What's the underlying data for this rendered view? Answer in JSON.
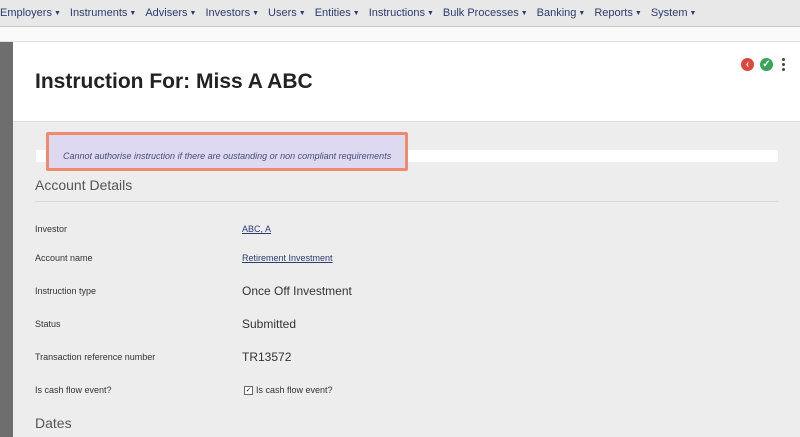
{
  "nav": [
    {
      "label": "Employers"
    },
    {
      "label": "Instruments"
    },
    {
      "label": "Advisers"
    },
    {
      "label": "Investors"
    },
    {
      "label": "Users"
    },
    {
      "label": "Entities"
    },
    {
      "label": "Instructions"
    },
    {
      "label": "Bulk Processes"
    },
    {
      "label": "Banking"
    },
    {
      "label": "Reports"
    },
    {
      "label": "System"
    }
  ],
  "page": {
    "title": "Instruction For: Miss A ABC",
    "message": "Cannot authorise instruction if there are oustanding or non compliant requirements"
  },
  "account_details": {
    "heading": "Account Details",
    "investor_label": "Investor",
    "investor_value": "ABC, A",
    "account_name_label": "Account name",
    "account_name_value": "Retirement Investment",
    "instruction_type_label": "Instruction type",
    "instruction_type_value": "Once Off Investment",
    "status_label": "Status",
    "status_value": "Submitted",
    "txn_ref_label": "Transaction reference number",
    "txn_ref_value": "TR13572",
    "cash_flow_label": "Is cash flow event?",
    "cash_flow_checkbox_label": "Is cash flow event?",
    "cash_flow_checked": true
  },
  "dates": {
    "heading": "Dates"
  },
  "colors": {
    "nav_text": "#2d3b6e",
    "back_button": "#d9483a",
    "approve_button": "#3aa55a",
    "highlight_border": "#f08a6e"
  }
}
